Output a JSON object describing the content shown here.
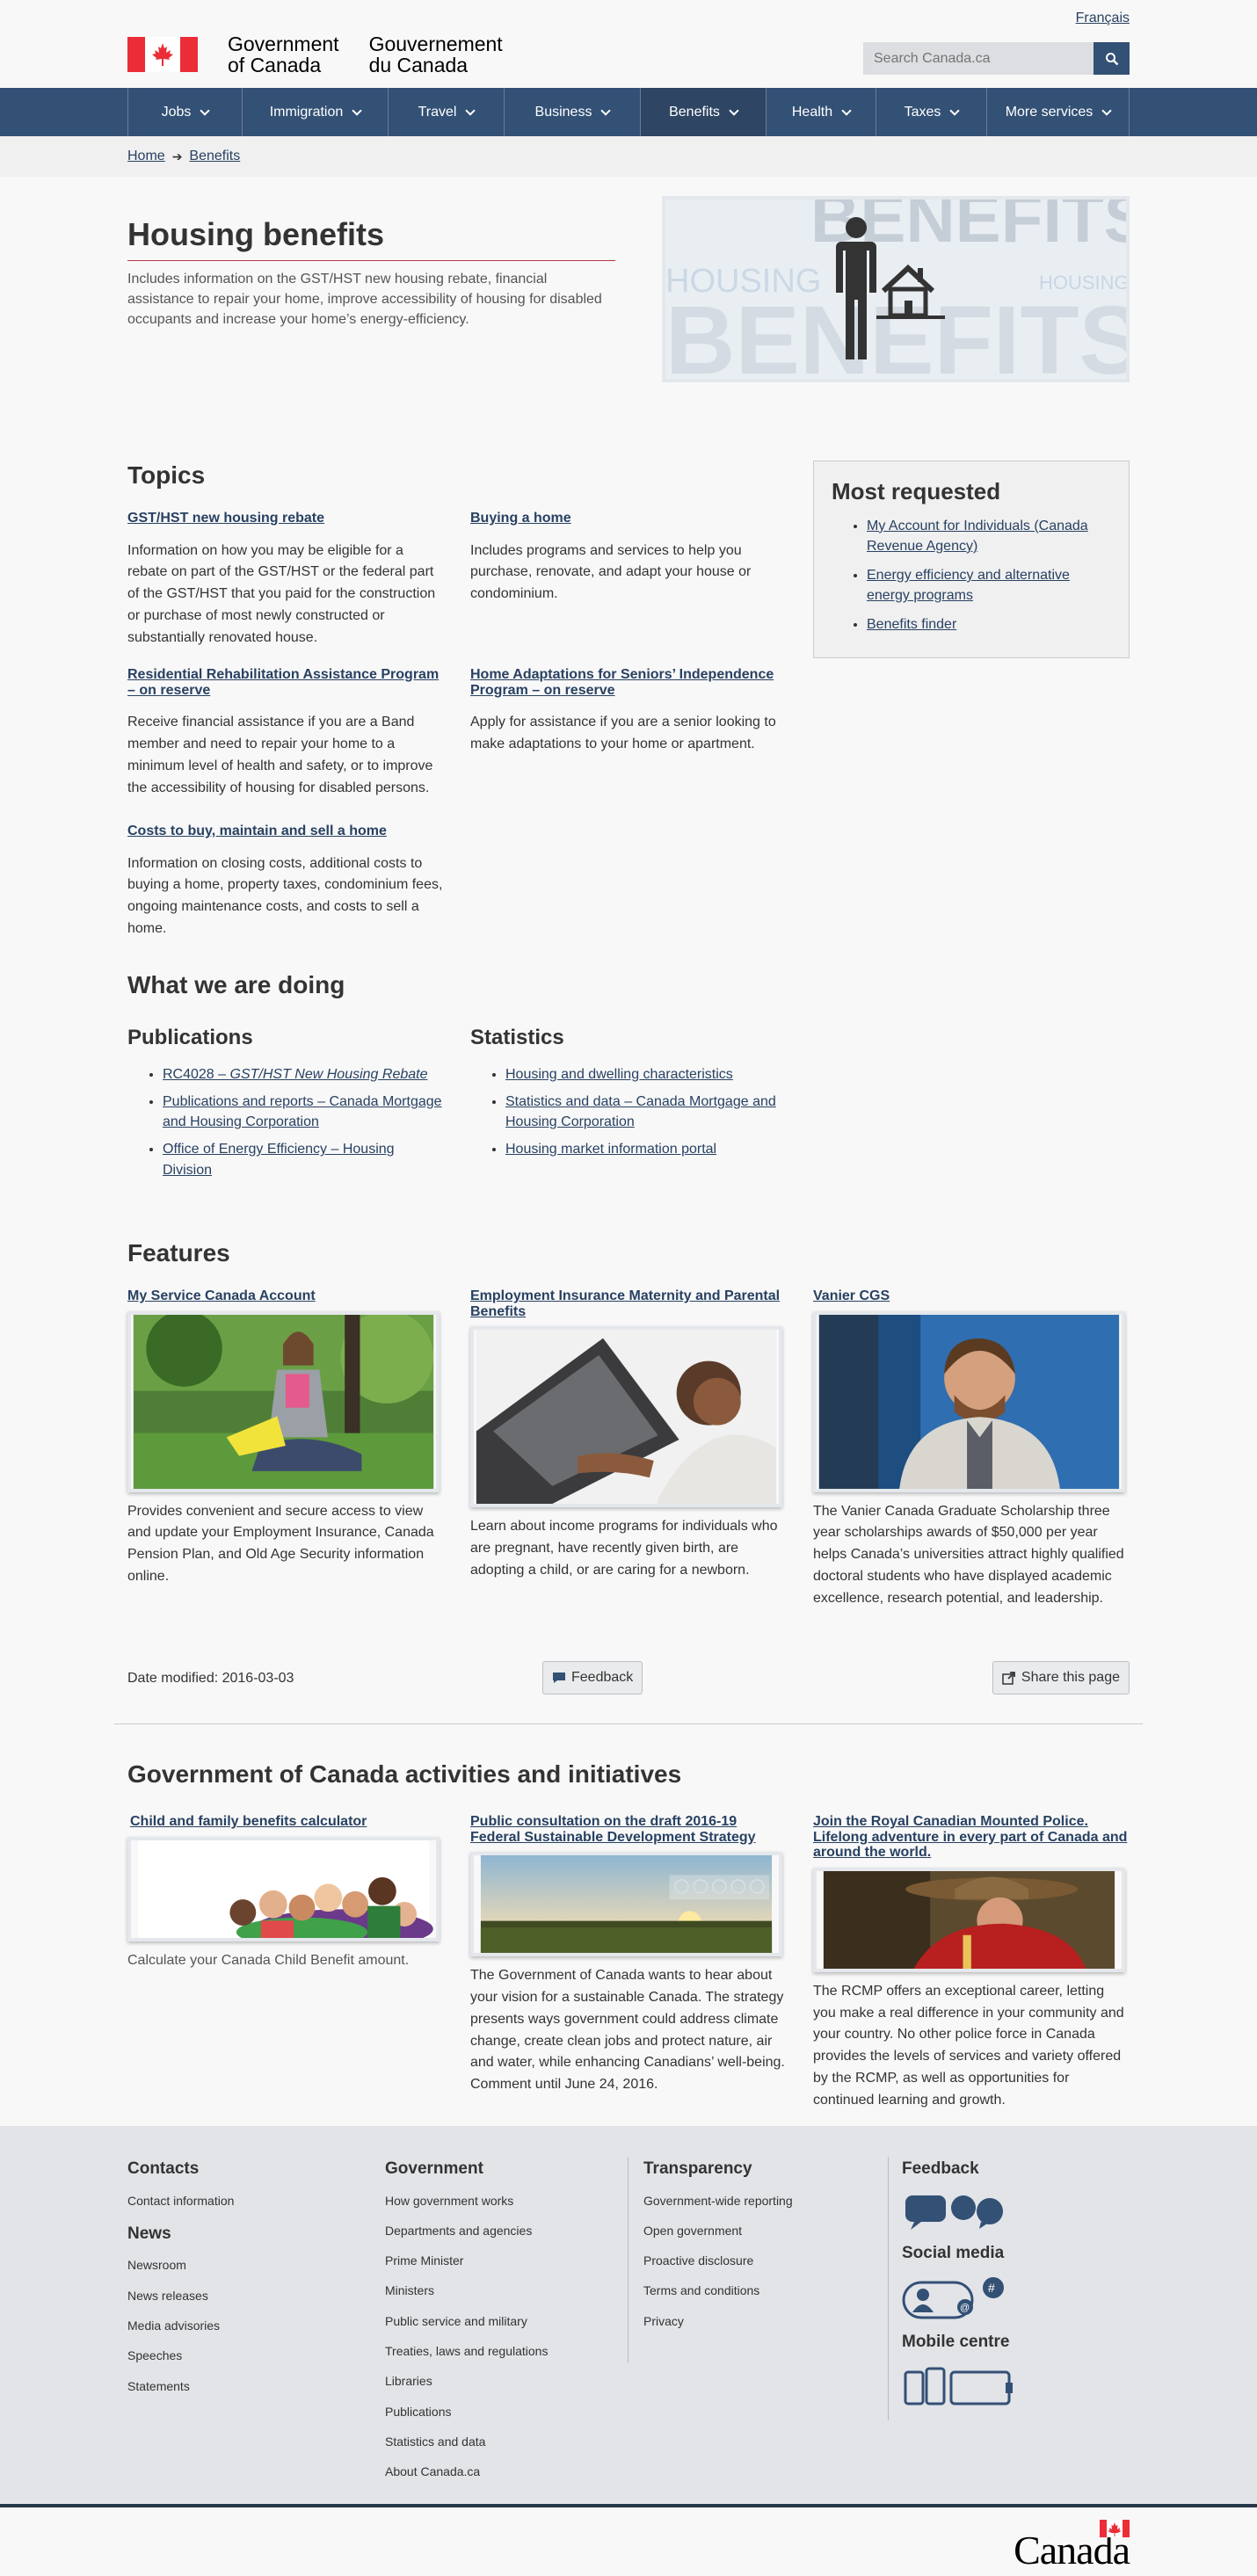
{
  "header": {
    "lang_link": "Français",
    "sig_en_line1": "Government",
    "sig_en_line2": "of Canada",
    "sig_fr_line1": "Gouvernement",
    "sig_fr_line2": "du Canada",
    "search_placeholder": "Search Canada.ca",
    "search_icon": "search-icon"
  },
  "menu": [
    {
      "label": "Jobs",
      "active": false
    },
    {
      "label": "Immigration",
      "active": false
    },
    {
      "label": "Travel",
      "active": false
    },
    {
      "label": "Business",
      "active": false
    },
    {
      "label": "Benefits",
      "active": true
    },
    {
      "label": "Health",
      "active": false
    },
    {
      "label": "Taxes",
      "active": false
    },
    {
      "label": "More services",
      "active": false
    }
  ],
  "breadcrumb": [
    "Home",
    "Benefits"
  ],
  "hero": {
    "title": "Housing benefits",
    "intro": "Includes information on the GST/HST new housing rebate, financial assistance to repair your home, improve accessibility of housing for disabled occupants and increase your home’s energy-efficiency.",
    "image_words": [
      "BENEFITS",
      "HOUSING",
      "BENEFITS",
      "HOUSING"
    ]
  },
  "topics": {
    "heading": "Topics",
    "items": [
      {
        "title": "GST/HST new housing rebate",
        "desc": "Information on how you may be eligible for a rebate on part of the GST/HST or the federal part of the GST/HST that you paid for the construction or purchase of most newly constructed or substantially renovated house."
      },
      {
        "title": "Buying a home",
        "desc": "Includes programs and services to help you purchase, renovate, and adapt your house or condominium."
      },
      {
        "title": "Residential Rehabilitation Assistance Program – on reserve",
        "desc": "Receive financial assistance if you are a Band member and need to repair your home to a minimum level of health and safety, or to improve the accessibility of housing for disabled persons."
      },
      {
        "title": "Home Adaptations for Seniors’ Independence Program – on reserve",
        "desc": "Apply for assistance if you are a senior looking to make adaptations to your home or apartment."
      },
      {
        "title": "Costs to buy, maintain and sell a home",
        "desc": "Information on closing costs, additional costs to buying a home, property taxes, condominium fees, ongoing maintenance costs, and costs to sell a home."
      }
    ]
  },
  "most_requested": {
    "heading": "Most requested",
    "items": [
      "My Account for Individuals (Canada Revenue Agency)",
      "Energy efficiency and alternative energy programs",
      "Benefits finder"
    ]
  },
  "doing": {
    "heading": "What we are doing",
    "publications": {
      "heading": "Publications",
      "items": [
        {
          "prefix": "RC4028 – ",
          "em": "GST/HST New Housing Rebate"
        },
        {
          "prefix": "Publications and reports – Canada Mortgage and Housing Corporation",
          "em": ""
        },
        {
          "prefix": "Office of Energy Efficiency – Housing Division",
          "em": ""
        }
      ]
    },
    "statistics": {
      "heading": "Statistics",
      "items": [
        "Housing and dwelling characteristics",
        "Statistics and data – Canada Mortgage and Housing Corporation",
        "Housing market information portal"
      ]
    }
  },
  "features": {
    "heading": "Features",
    "items": [
      {
        "title": "My Service Canada Account",
        "desc": "Provides convenient and secure access to view and update your Employment Insurance, Canada Pension Plan, and Old Age Security information online."
      },
      {
        "title": "Employment Insurance Maternity and Parental Benefits",
        "desc": "Learn about income programs for individuals who are pregnant, have recently given birth, are adopting a child, or are caring for a newborn."
      },
      {
        "title": "Vanier CGS",
        "desc": "The Vanier Canada Graduate Scholarship three year scholarships awards of $50,000 per year helps Canada’s universities attract highly qualified doctoral students who have displayed academic excellence, research potential, and leadership."
      }
    ]
  },
  "page_meta": {
    "date_modified": "Date modified: 2016-03-03",
    "feedback": "Feedback",
    "share": "Share this page"
  },
  "activities": {
    "heading": "Government of Canada activities and initiatives",
    "items": [
      {
        "title": "Child and family benefits calculator",
        "desc": "Calculate your Canada Child Benefit amount."
      },
      {
        "title": "Public consultation on the draft 2016-19 Federal Sustainable Development Strategy",
        "desc": "The Government of Canada wants to hear about your vision for a sustainable Canada. The strategy presents ways government could address climate change, create clean jobs and protect nature, air and water, while enhancing Canadians’ well-being. Comment until June 24, 2016."
      },
      {
        "title": "Join the Royal Canadian Mounted Police. Lifelong adventure in every part of Canada and around the world.",
        "desc": "The RCMP offers an exceptional career, letting you make a real difference in your community and your country. No other police force in Canada provides the levels of services and variety offered by the RCMP, as well as opportunities for continued learning and growth."
      }
    ]
  },
  "footer": {
    "contacts": {
      "heading": "Contacts",
      "items": [
        "Contact information"
      ]
    },
    "news": {
      "heading": "News",
      "items": [
        "Newsroom",
        "News releases",
        "Media advisories",
        "Speeches",
        "Statements"
      ]
    },
    "government": {
      "heading": "Government",
      "items": [
        "How government works",
        "Departments and agencies",
        "Prime Minister",
        "Ministers",
        "Public service and military",
        "Treaties, laws and regulations",
        "Libraries",
        "Publications",
        "Statistics and data",
        "About Canada.ca"
      ]
    },
    "transparency": {
      "heading": "Transparency",
      "items": [
        "Government-wide reporting",
        "Open government",
        "Proactive disclosure",
        "Terms and conditions",
        "Privacy"
      ]
    },
    "feedback": {
      "heading": "Feedback"
    },
    "social": {
      "heading": "Social media"
    },
    "mobile": {
      "heading": "Mobile centre"
    },
    "wordmark": "Canada"
  },
  "colors": {
    "brand_blue": "#335075",
    "link": "#284162",
    "flag_red": "#eb2d37",
    "footer_bg": "#e2e4e8"
  }
}
